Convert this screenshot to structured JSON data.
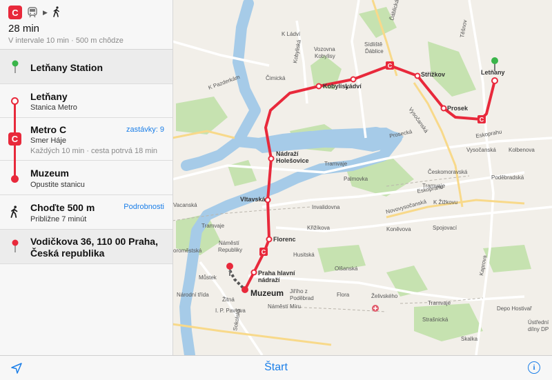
{
  "summary": {
    "duration": "28 min",
    "details": "V intervale 10 min · 500 m chôdze",
    "line_badge": "C",
    "mode_icons": [
      "metro-c-badge",
      "train-icon",
      "chevron-right-icon",
      "walking-icon"
    ]
  },
  "steps": {
    "origin": {
      "title": "Letňany Station",
      "icon": "green-pin-icon"
    },
    "board": {
      "title": "Letňany",
      "subtitle": "Stanica Metro"
    },
    "ride": {
      "title": "Metro C",
      "subtitle": "Smer Háje",
      "detail": "Každých 10 min · cesta potrvá 18 min",
      "stops_link": "zastávky: 9",
      "line_badge": "C"
    },
    "alight": {
      "title": "Muzeum",
      "subtitle": "Opustite stanicu"
    },
    "walk": {
      "title": "Choďte 500 m",
      "subtitle": "Približne 7 minút",
      "link": "Podrobnosti"
    },
    "destination": {
      "line1": "Vodičkova 36, 110 00 Praha,",
      "line2": "Česká republika",
      "icon": "red-pin-icon"
    }
  },
  "toolbar": {
    "start_label": "Štart",
    "info_label": "i",
    "location_icon": "location-arrow-icon"
  },
  "map": {
    "colors": {
      "metro_c": "#e8293b",
      "water": "#a6cbe8",
      "park": "#c6e2b0",
      "background": "#f2efe9"
    },
    "stations": {
      "letnany": "Letňany",
      "prosek": "Prosek",
      "strizkov": "Střížkov",
      "ladvi": "Ládví",
      "kobylisy": "Kobylisy",
      "holesovice_1": "Nádraží",
      "holesovice_2": "Holešovice",
      "vltavska": "Vltavská",
      "florenc": "Florenc",
      "hlavni_1": "Praha hlavní",
      "hlavni_2": "nádraží",
      "muzeum": "Muzeum"
    },
    "labels": {
      "k_ladvi": "K Ládví",
      "sidliste_1": "Sídliště",
      "sidliste_2": "Ďáblice",
      "vozovna_1": "Vozovna",
      "vozovna_2": "Kobylisy",
      "cimicka": "Čimická",
      "k_pazderkam": "K Pazderkám",
      "prosecka": "Prosecká",
      "vysocanska_1": "Vysočanská",
      "kolbenova": "Kolbenova",
      "ceskomoravska": "Českomoravská",
      "podebradska_1": "Poděbradská",
      "palmovka": "Palmovka",
      "invalidovna": "Invalidovna",
      "krizikova": "Křižíkova",
      "konevova": "Koněvova",
      "spojovaci": "Spojovací",
      "namesti_1": "Náměstí",
      "namesti_2": "Republiky",
      "mustek": "Můstek",
      "narodni": "Národní třída",
      "zitna": "Žitná",
      "ip_pavlova": "I. P. Pavlova",
      "namesti_miru": "Náměstí Míru",
      "jiriho_1": "Jiřího z",
      "jiriho_2": "Poděbrad",
      "flora": "Flora",
      "zelivskeho": "Želivského",
      "strasnicka": "Strašnická",
      "skalka": "Skalka",
      "depo": "Depo Hostivař",
      "ustredni_1": "Ústřední",
      "ustredni_2": "dílny DP",
      "olsanska": "Olšanská",
      "husitska": "Husitská",
      "sokolska": "Sokolská",
      "eskoprahu_1": "Eskoprahu",
      "vysocanska_2": "Vysočanská",
      "novovysocanska": "Novovysočanská",
      "k_zizkovu": "K Žižkovu",
      "tramvaj_1": "Tramvaje",
      "tramvaj_2": "Tramvaje",
      "tramvaj_3": "Tramvaje",
      "tramvaj_4": "Tramvaje",
      "oromestska": "oroměstská",
      "vacanska": "Vacanská",
      "eskoprahu_2": "Eskoprahu",
      "dablicka": "Ďáblická",
      "kobyliska": "Kobyliská",
      "kaprova": "Kaprova",
      "tesnov": "Těšnov"
    }
  }
}
